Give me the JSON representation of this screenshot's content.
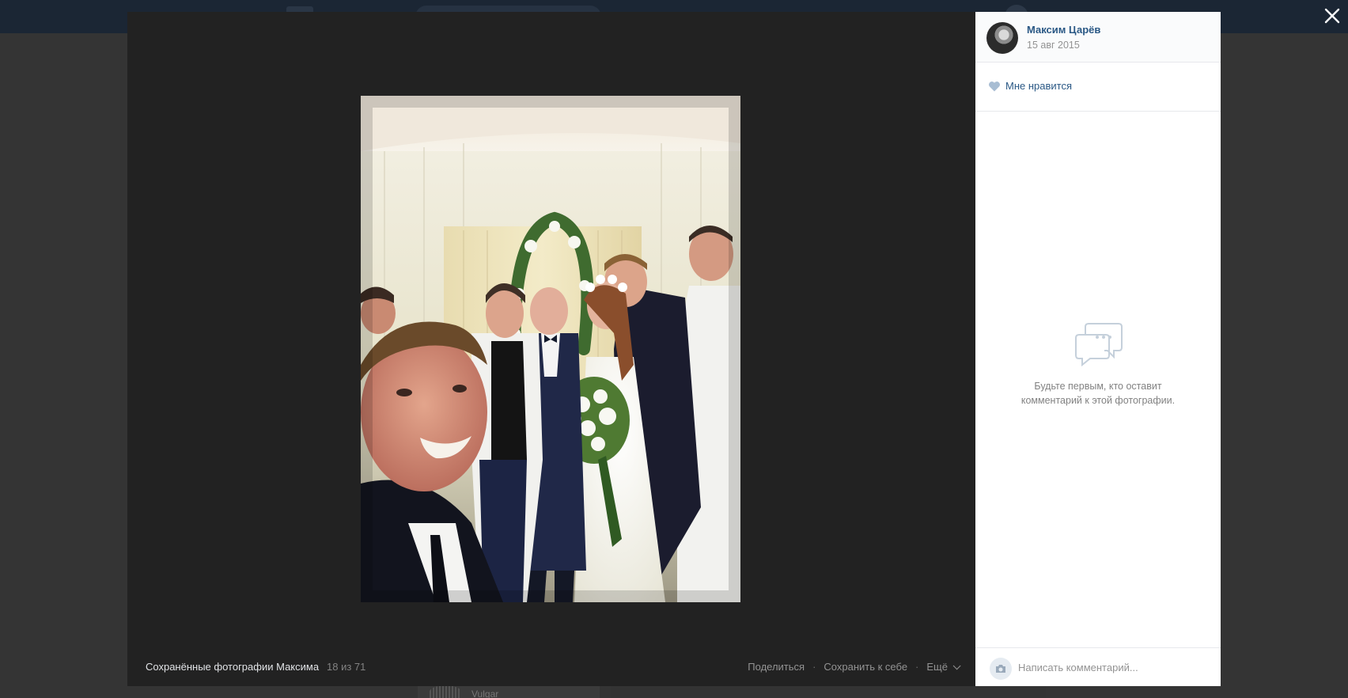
{
  "author": {
    "name": "Максим Царёв",
    "date": "15 авг 2015"
  },
  "like": {
    "label": "Мне нравится"
  },
  "comments": {
    "empty_text": "Будьте первым, кто оставит комментарий к этой фотографии.",
    "input_placeholder": "Написать комментарий..."
  },
  "album": {
    "title": "Сохранённые фотографии Максима",
    "counter": "18 из 71"
  },
  "actions": {
    "share": "Поделиться",
    "save": "Сохранить к себе",
    "more": "Ещё",
    "separator": "·"
  },
  "background": {
    "card_text": "Vulgar"
  },
  "icons": {
    "close": "close-icon",
    "like": "heart-icon",
    "comments": "comment-bubbles-icon",
    "camera": "camera-icon",
    "more": "chevron-down-icon"
  }
}
